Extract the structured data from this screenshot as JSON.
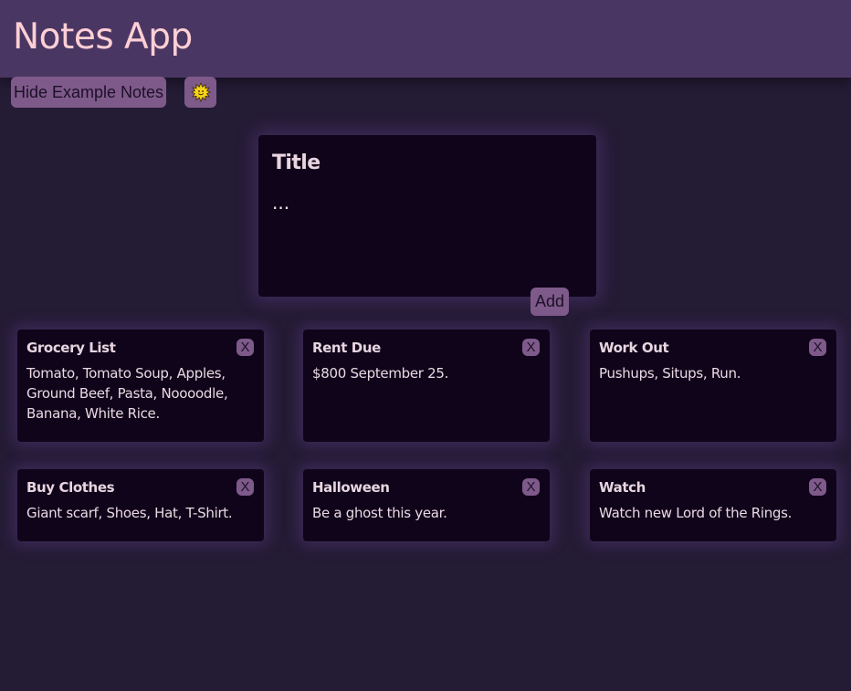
{
  "header": {
    "title": "Notes App"
  },
  "toolbar": {
    "hide_examples_label": "Hide Example Notes",
    "theme_toggle_icon": "sun-icon"
  },
  "composer": {
    "title_placeholder": "Title",
    "body_placeholder": "...",
    "add_label": "Add"
  },
  "colors": {
    "header_bg": "#4a3663",
    "page_bg": "#241b35",
    "card_bg": "#10041a",
    "button_bg": "#7e5a8a",
    "title_text": "#ffcfd4"
  },
  "notes": [
    {
      "title": "Grocery List",
      "body": "Tomato, Tomato Soup, Apples, Ground Beef, Pasta, Noooodle, Banana, White Rice.",
      "close_label": "X"
    },
    {
      "title": "Rent Due",
      "body": "$800 September 25.",
      "close_label": "X"
    },
    {
      "title": "Work Out",
      "body": "Pushups, Situps, Run.",
      "close_label": "X"
    },
    {
      "title": "Buy Clothes",
      "body": "Giant scarf, Shoes, Hat, T-Shirt.",
      "close_label": "X"
    },
    {
      "title": "Halloween",
      "body": "Be a ghost this year.",
      "close_label": "X"
    },
    {
      "title": "Watch",
      "body": "Watch new Lord of the Rings.",
      "close_label": "X"
    }
  ]
}
